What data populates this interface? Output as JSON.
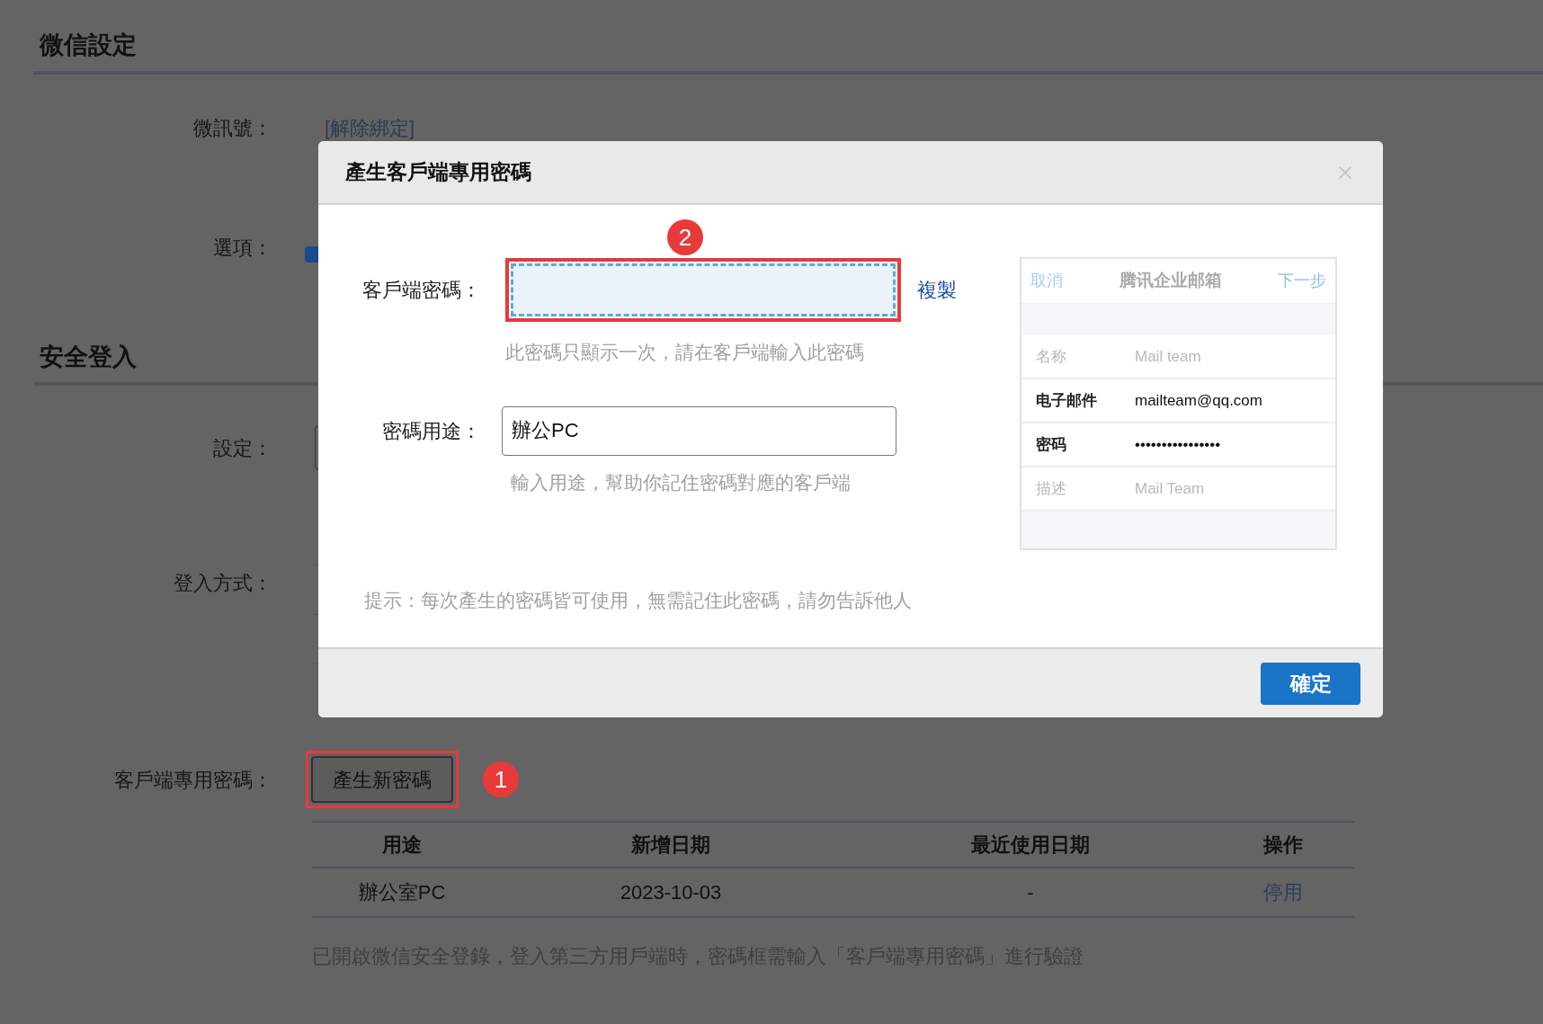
{
  "wechat_section": {
    "title": "微信設定",
    "account_label": "微訊號：",
    "unbind_link": "[解除綁定]",
    "options_label": "選項：",
    "option_checked": true
  },
  "security_section": {
    "title": "安全登入",
    "setting_label": "設定：",
    "login_method_label": "登入方式：",
    "client_password_label": "客戶端專用密碼：",
    "generate_button": "產生新密碼",
    "table": {
      "columns": [
        "用途",
        "新增日期",
        "最近使用日期",
        "操作"
      ],
      "rows": [
        {
          "purpose": "辦公室PC",
          "added": "2023-10-03",
          "last_used": "-",
          "action": "停用"
        }
      ]
    },
    "note": "已開啟微信安全登錄，登入第三方用戶端時，密碼框需輸入「客戶端專用密碼」進行驗證"
  },
  "annotations": [
    {
      "number": "1"
    },
    {
      "number": "2"
    }
  ],
  "dialog": {
    "title": "產生客戶端專用密碼",
    "password_label": "客戶端密碼：",
    "copy_link": "複製",
    "password_hint": "此密碼只顯示一次，請在客戶端輸入此密碼",
    "purpose_label": "密碼用途：",
    "purpose_value": "辦公PC",
    "purpose_hint": "輸入用途，幫助你記住密碼對應的客戶端",
    "tip": "提示：每次產生的密碼皆可使用，無需記住此密碼，請勿告訴他人",
    "confirm_button": "確定",
    "preview": {
      "cancel": "取消",
      "title": "腾讯企业邮箱",
      "next": "下一步",
      "rows": [
        {
          "label": "名称",
          "value": "Mail team",
          "kind": "muted"
        },
        {
          "label": "电子邮件",
          "value": "mailteam@qq.com",
          "kind": "strong"
        },
        {
          "label": "密码",
          "value": "••••••••••••••••",
          "kind": "strong"
        },
        {
          "label": "描述",
          "value": "Mail Team",
          "kind": "muted"
        }
      ]
    }
  }
}
